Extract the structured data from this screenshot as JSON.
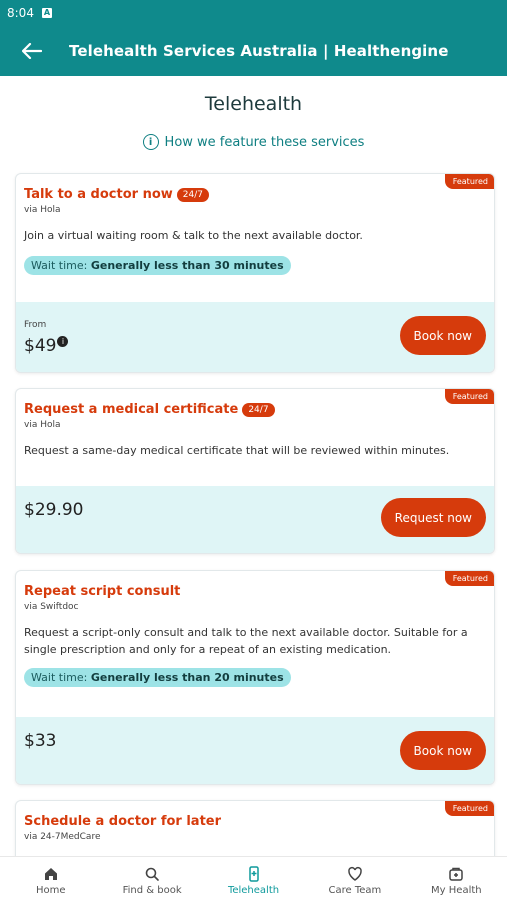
{
  "status_bar": {
    "time": "8:04",
    "icon": "A"
  },
  "app_bar": {
    "title": "Telehealth Services Australia | Healthengine",
    "back_icon": "arrow-left-icon"
  },
  "page": {
    "heading": "Telehealth",
    "feature_link": "How we feature these services"
  },
  "cards": [
    {
      "featured": "Featured",
      "title": "Talk to a doctor now",
      "badge": "24/7",
      "via": "via Hola",
      "description": "Join a virtual waiting room & talk to the next available doctor.",
      "wait_label": "Wait time:",
      "wait_value": "Generally less than 30 minutes",
      "from_label": "From",
      "price": "$49",
      "cta": "Book now"
    },
    {
      "featured": "Featured",
      "title": "Request a medical certificate",
      "badge": "24/7",
      "via": "via Hola",
      "description": "Request a same-day medical certificate that will be reviewed within minutes.",
      "price": "$29.90",
      "cta": "Request now"
    },
    {
      "featured": "Featured",
      "title": "Repeat script consult",
      "via": "via Swiftdoc",
      "description": "Request a script-only consult and talk to the next available doctor. Suitable for a single prescription and only for a repeat of an existing medication.",
      "wait_label": "Wait time:",
      "wait_value": "Generally less than 20 minutes",
      "price": "$33",
      "cta": "Book now"
    },
    {
      "featured": "Featured",
      "title": "Schedule a doctor for later",
      "via": "via 24-7MedCare"
    }
  ],
  "nav": {
    "home": "Home",
    "find_book": "Find & book",
    "telehealth": "Telehealth",
    "care_team": "Care Team",
    "my_health": "My Health"
  },
  "colors": {
    "brand_teal": "#0f8a8c",
    "accent_orange": "#d63b0c",
    "wait_pill": "#9de3e6",
    "price_panel": "#dff5f6"
  }
}
